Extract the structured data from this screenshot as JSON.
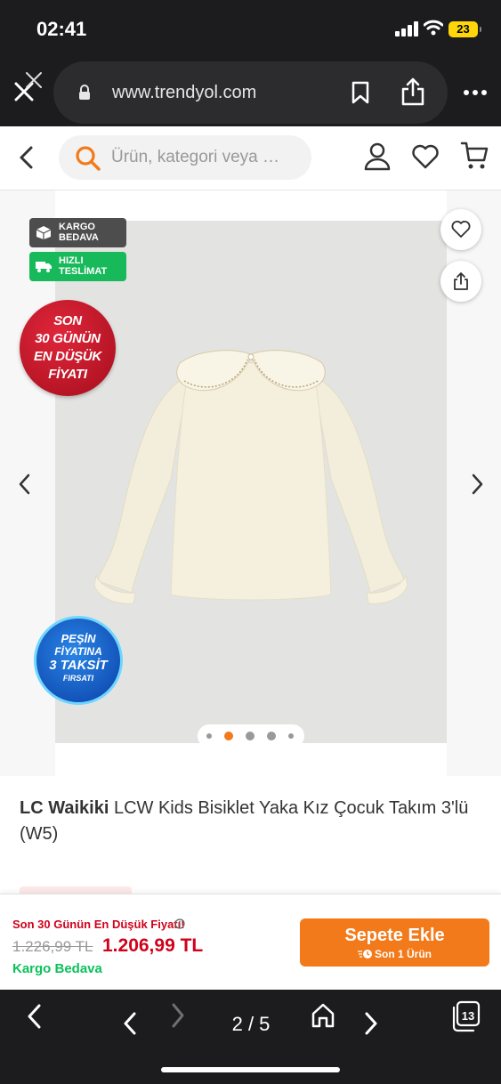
{
  "status_bar": {
    "time": "02:41",
    "battery": "23"
  },
  "browser": {
    "url": "www.trendyol.com"
  },
  "header": {
    "search_placeholder": "Ürün, kategori veya …"
  },
  "gallery": {
    "badges": [
      {
        "lines": [
          "KARGO",
          "BEDAVA"
        ]
      },
      {
        "lines": [
          "HIZLI",
          "TESLİMAT"
        ]
      }
    ],
    "seal_lines": [
      "SON",
      "30 GÜNÜN",
      "EN DÜŞÜK",
      "FİYATI"
    ],
    "taksit_lines": [
      "PEŞİN",
      "FİYATINA",
      "3 TAKSİT",
      "FIRSATI"
    ],
    "current_index": 2,
    "dot_count": 5
  },
  "product": {
    "brand": "LC Waikiki",
    "name": "LCW Kids Bisiklet Yaka Kız Çocuk Takım 3'lü (W5)"
  },
  "buy_bar": {
    "lowest_note": "Son 30 Günün En Düşük Fiyatı!",
    "old_price": "1.226,99 TL",
    "new_price": "1.206,99 TL",
    "free_shipping": "Kargo Bedava",
    "cart_button": "Sepete Ekle",
    "cart_button_sub": "Son 1 Ürün"
  },
  "toolbar": {
    "page_counter": "2 / 5",
    "tab_count": "13"
  },
  "colors": {
    "accent": "#f27a1a",
    "price_red": "#d0021b",
    "green": "#0bc15c",
    "chrome": "#1c1c1e"
  }
}
